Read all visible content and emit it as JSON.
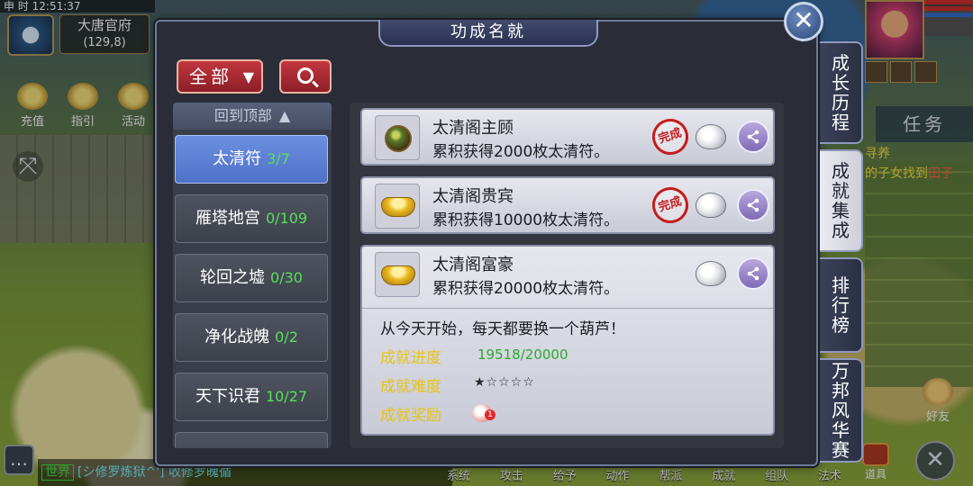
{
  "hud": {
    "time": "申 时   12:51:37",
    "location_name": "大唐官府",
    "coords": "(129,8)",
    "buttons": [
      {
        "label": "充值"
      },
      {
        "label": "指引"
      },
      {
        "label": "活动"
      }
    ],
    "task_tab": "任务",
    "quest_line1": "寻养",
    "quest_line2_a": "的子女找到",
    "quest_line2_b": "田子",
    "friend_label": "好友",
    "bag_label": "道具"
  },
  "chat": {
    "channel": "世界",
    "text": "[シ修罗炼狱^'] 收修罗魄循"
  },
  "bottom_menu": [
    "系统",
    "攻击",
    "给予",
    "动作",
    "帮派",
    "成就",
    "组队",
    "法术"
  ],
  "modal": {
    "title": "功成名就",
    "filter_label": "全部",
    "back_to_top": "回到顶部",
    "categories": [
      {
        "name": "太清符",
        "count": "3/7"
      },
      {
        "name": "雁塔地宫",
        "count": "0/109"
      },
      {
        "name": "轮回之墟",
        "count": "0/30"
      },
      {
        "name": "净化战魄",
        "count": "0/2"
      },
      {
        "name": "天下识君",
        "count": "10/27"
      }
    ],
    "achievements": [
      {
        "name": "太清阁主顾",
        "desc": "累积获得2000枚太清符。",
        "icon": "jade-orb-icon",
        "completed": true,
        "stamp": "完成"
      },
      {
        "name": "太清阁贵宾",
        "desc": "累积获得10000枚太清符。",
        "icon": "gold-ingot-icon",
        "completed": true,
        "stamp": "完成"
      },
      {
        "name": "太清阁富豪",
        "desc": "累积获得20000枚太清符。",
        "icon": "gold-ingot-icon",
        "completed": false
      }
    ],
    "detail": {
      "flavor": "从今天开始，每天都要换一个葫芦！",
      "progress_label": "成就进度",
      "progress_value": "19518/20000",
      "progress_fraction": 0.9759,
      "difficulty_label": "成就难度",
      "difficulty_stars": "★☆☆☆☆",
      "reward_label": "成就奖励",
      "reward_count": "1"
    },
    "side_tabs": [
      {
        "label": "成长历程",
        "active": false
      },
      {
        "label": "成就集成",
        "active": true
      },
      {
        "label": "排行榜",
        "active": false
      },
      {
        "label": "万邦风华赛",
        "active": false
      }
    ]
  },
  "colors": {
    "accent_red": "#c2363e",
    "active_blue": "#5b7fd4",
    "count_green": "#58e058",
    "label_yellow": "#e6c41a"
  }
}
